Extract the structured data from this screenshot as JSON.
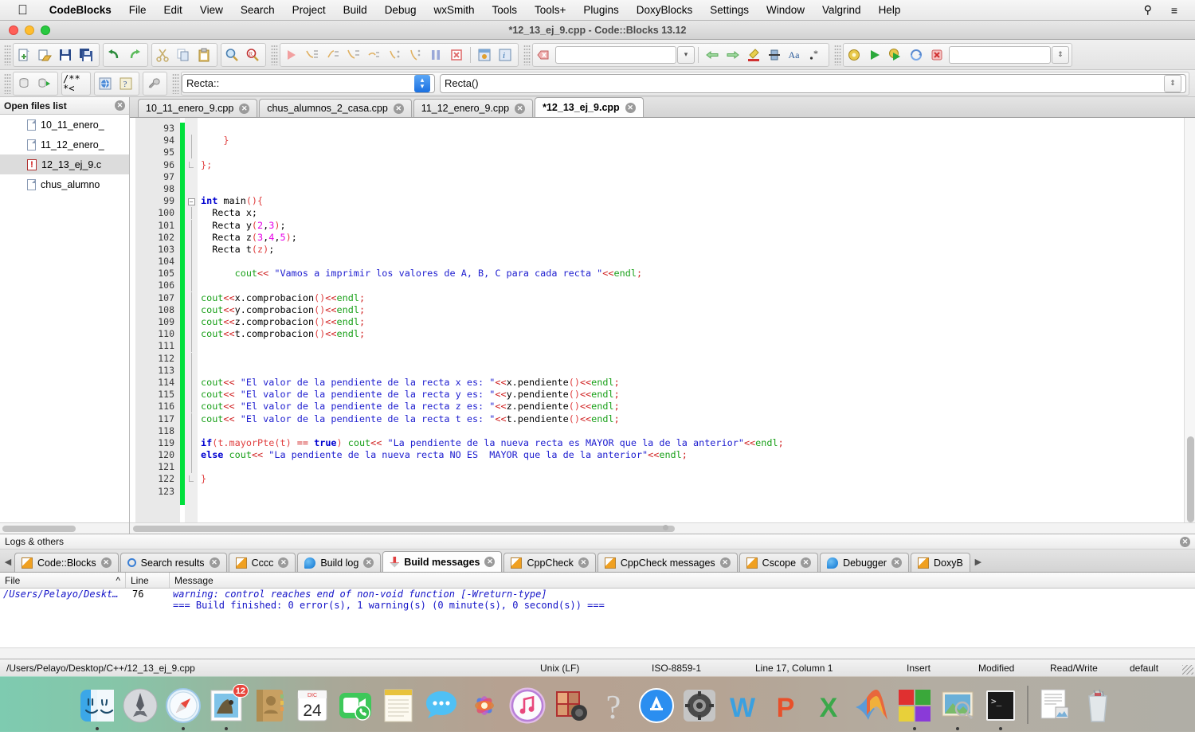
{
  "menubar": {
    "apple_icon": "apple-logo-icon",
    "app_name": "CodeBlocks",
    "items": [
      "File",
      "Edit",
      "View",
      "Search",
      "Project",
      "Build",
      "Debug",
      "wxSmith",
      "Tools",
      "Tools+",
      "Plugins",
      "DoxyBlocks",
      "Settings",
      "Window",
      "Valgrind",
      "Help"
    ],
    "right_icons": [
      "search-icon",
      "control-center-icon"
    ]
  },
  "window": {
    "title": "*12_13_ej_9.cpp - Code::Blocks 13.12"
  },
  "toolbar1": {
    "file_group": [
      "new-file-icon",
      "open-file-icon",
      "save-icon",
      "save-all-icon"
    ],
    "undo_group": [
      "undo-icon",
      "redo-icon"
    ],
    "clipboard_group": [
      "cut-icon",
      "copy-icon",
      "paste-icon"
    ],
    "find_group": [
      "find-icon",
      "replace-icon"
    ],
    "debug_group": [
      "debug-run-icon",
      "debug-next-line-icon",
      "debug-step-into-icon",
      "debug-step-out-icon",
      "debug-next-instruction-icon",
      "debug-step-into-instruction-icon",
      "debug-step-out-function-icon",
      "debug-break-icon",
      "debug-stop-icon",
      "debugging-windows-icon",
      "debug-info-icon"
    ],
    "search_value": "",
    "search_placeholder": "",
    "goto_icons": [
      "prev-icon",
      "next-icon",
      "highlight-icon",
      "bookmark-icon",
      "match-case-icon",
      "regex-icon"
    ],
    "build_group": [
      "build-icon",
      "run-icon",
      "build-and-run-icon",
      "rebuild-icon",
      "abort-icon"
    ],
    "target_value": "",
    "target_placeholder": ""
  },
  "toolbar2": {
    "doxy_group": [
      "doxyblocks-run-icon",
      "doxyblocks-extract-icon"
    ],
    "comment_group": [
      "block-comment-icon",
      "line-comment-icon"
    ],
    "help_group": [
      "doxyblocks-html-icon",
      "doxyblocks-help-icon"
    ],
    "config_group": [
      "doxyblocks-config-icon"
    ],
    "scope_value": "Recta::",
    "function_value": "Recta()"
  },
  "sidebar": {
    "title": "Open files list",
    "close_icon": "close-icon",
    "files": [
      {
        "name": "10_11_enero_",
        "icon": "document-icon",
        "selected": false
      },
      {
        "name": "11_12_enero_",
        "icon": "document-icon",
        "selected": false
      },
      {
        "name": "12_13_ej_9.c",
        "icon": "warning-document-icon",
        "selected": true
      },
      {
        "name": "chus_alumno",
        "icon": "document-icon",
        "selected": false
      }
    ]
  },
  "editor_tabs": [
    {
      "label": "10_11_enero_9.cpp",
      "active": false
    },
    {
      "label": "chus_alumnos_2_casa.cpp",
      "active": false
    },
    {
      "label": "11_12_enero_9.cpp",
      "active": false
    },
    {
      "label": "*12_13_ej_9.cpp",
      "active": true
    }
  ],
  "editor": {
    "first_line": 93,
    "lines": [
      {
        "n": 93,
        "fold": "",
        "tokens": []
      },
      {
        "n": 94,
        "fold": "|",
        "tokens": [
          {
            "t": "    ",
            "c": "k-id"
          },
          {
            "t": "}",
            "c": "k-brace"
          }
        ]
      },
      {
        "n": 95,
        "fold": "|",
        "tokens": []
      },
      {
        "n": 96,
        "fold": "L",
        "tokens": [
          {
            "t": "};",
            "c": "k-brace"
          }
        ]
      },
      {
        "n": 97,
        "fold": "",
        "tokens": []
      },
      {
        "n": 98,
        "fold": "",
        "tokens": []
      },
      {
        "n": 99,
        "fold": "-",
        "tokens": [
          {
            "t": "int",
            "c": "k-type"
          },
          {
            "t": " main",
            "c": "k-id"
          },
          {
            "t": "()",
            "c": "k-paren"
          },
          {
            "t": "{",
            "c": "k-brace"
          }
        ]
      },
      {
        "n": 100,
        "fold": "|",
        "tokens": [
          {
            "t": "  Recta x;",
            "c": "k-id"
          }
        ]
      },
      {
        "n": 101,
        "fold": "|",
        "tokens": [
          {
            "t": "  Recta y",
            "c": "k-id"
          },
          {
            "t": "(",
            "c": "k-paren"
          },
          {
            "t": "2",
            "c": "k-num"
          },
          {
            "t": ",",
            "c": "k-id"
          },
          {
            "t": "3",
            "c": "k-num"
          },
          {
            "t": ")",
            "c": "k-paren"
          },
          {
            "t": ";",
            "c": "k-id"
          }
        ]
      },
      {
        "n": 102,
        "fold": "|",
        "tokens": [
          {
            "t": "  Recta z",
            "c": "k-id"
          },
          {
            "t": "(",
            "c": "k-paren"
          },
          {
            "t": "3",
            "c": "k-num"
          },
          {
            "t": ",",
            "c": "k-id"
          },
          {
            "t": "4",
            "c": "k-num"
          },
          {
            "t": ",",
            "c": "k-id"
          },
          {
            "t": "5",
            "c": "k-num"
          },
          {
            "t": ")",
            "c": "k-paren"
          },
          {
            "t": ";",
            "c": "k-id"
          }
        ]
      },
      {
        "n": 103,
        "fold": "|",
        "tokens": [
          {
            "t": "  Recta t",
            "c": "k-id"
          },
          {
            "t": "(z)",
            "c": "k-paren"
          },
          {
            "t": ";",
            "c": "k-id"
          }
        ]
      },
      {
        "n": 104,
        "fold": "|",
        "tokens": []
      },
      {
        "n": 105,
        "fold": "|",
        "tokens": [
          {
            "t": "      cout",
            "c": "k-std"
          },
          {
            "t": "<<",
            "c": "k-op"
          },
          {
            "t": " \"Vamos a imprimir los valores de A, B, C para cada recta \"",
            "c": "k-str"
          },
          {
            "t": "<<",
            "c": "k-op"
          },
          {
            "t": "endl",
            "c": "k-std"
          },
          {
            "t": ";",
            "c": "k-op"
          }
        ]
      },
      {
        "n": 106,
        "fold": "|",
        "tokens": []
      },
      {
        "n": 107,
        "fold": "|",
        "tokens": [
          {
            "t": "cout",
            "c": "k-std"
          },
          {
            "t": "<<",
            "c": "k-op"
          },
          {
            "t": "x.comprobacion",
            "c": "k-id"
          },
          {
            "t": "()",
            "c": "k-paren"
          },
          {
            "t": "<<",
            "c": "k-op"
          },
          {
            "t": "endl",
            "c": "k-std"
          },
          {
            "t": ";",
            "c": "k-op"
          }
        ]
      },
      {
        "n": 108,
        "fold": "|",
        "tokens": [
          {
            "t": "cout",
            "c": "k-std"
          },
          {
            "t": "<<",
            "c": "k-op"
          },
          {
            "t": "y.comprobacion",
            "c": "k-id"
          },
          {
            "t": "()",
            "c": "k-paren"
          },
          {
            "t": "<<",
            "c": "k-op"
          },
          {
            "t": "endl",
            "c": "k-std"
          },
          {
            "t": ";",
            "c": "k-op"
          }
        ]
      },
      {
        "n": 109,
        "fold": "|",
        "tokens": [
          {
            "t": "cout",
            "c": "k-std"
          },
          {
            "t": "<<",
            "c": "k-op"
          },
          {
            "t": "z.comprobacion",
            "c": "k-id"
          },
          {
            "t": "()",
            "c": "k-paren"
          },
          {
            "t": "<<",
            "c": "k-op"
          },
          {
            "t": "endl",
            "c": "k-std"
          },
          {
            "t": ";",
            "c": "k-op"
          }
        ]
      },
      {
        "n": 110,
        "fold": "|",
        "tokens": [
          {
            "t": "cout",
            "c": "k-std"
          },
          {
            "t": "<<",
            "c": "k-op"
          },
          {
            "t": "t.comprobacion",
            "c": "k-id"
          },
          {
            "t": "()",
            "c": "k-paren"
          },
          {
            "t": "<<",
            "c": "k-op"
          },
          {
            "t": "endl",
            "c": "k-std"
          },
          {
            "t": ";",
            "c": "k-op"
          }
        ]
      },
      {
        "n": 111,
        "fold": "|",
        "tokens": []
      },
      {
        "n": 112,
        "fold": "|",
        "tokens": []
      },
      {
        "n": 113,
        "fold": "|",
        "tokens": []
      },
      {
        "n": 114,
        "fold": "|",
        "tokens": [
          {
            "t": "cout",
            "c": "k-std"
          },
          {
            "t": "<<",
            "c": "k-op"
          },
          {
            "t": " \"El valor de la pendiente de la recta x es: \"",
            "c": "k-str"
          },
          {
            "t": "<<",
            "c": "k-op"
          },
          {
            "t": "x.pendiente",
            "c": "k-id"
          },
          {
            "t": "()",
            "c": "k-paren"
          },
          {
            "t": "<<",
            "c": "k-op"
          },
          {
            "t": "endl",
            "c": "k-std"
          },
          {
            "t": ";",
            "c": "k-op"
          }
        ]
      },
      {
        "n": 115,
        "fold": "|",
        "tokens": [
          {
            "t": "cout",
            "c": "k-std"
          },
          {
            "t": "<<",
            "c": "k-op"
          },
          {
            "t": " \"El valor de la pendiente de la recta y es: \"",
            "c": "k-str"
          },
          {
            "t": "<<",
            "c": "k-op"
          },
          {
            "t": "y.pendiente",
            "c": "k-id"
          },
          {
            "t": "()",
            "c": "k-paren"
          },
          {
            "t": "<<",
            "c": "k-op"
          },
          {
            "t": "endl",
            "c": "k-std"
          },
          {
            "t": ";",
            "c": "k-op"
          }
        ]
      },
      {
        "n": 116,
        "fold": "|",
        "tokens": [
          {
            "t": "cout",
            "c": "k-std"
          },
          {
            "t": "<<",
            "c": "k-op"
          },
          {
            "t": " \"El valor de la pendiente de la recta z es: \"",
            "c": "k-str"
          },
          {
            "t": "<<",
            "c": "k-op"
          },
          {
            "t": "z.pendiente",
            "c": "k-id"
          },
          {
            "t": "()",
            "c": "k-paren"
          },
          {
            "t": "<<",
            "c": "k-op"
          },
          {
            "t": "endl",
            "c": "k-std"
          },
          {
            "t": ";",
            "c": "k-op"
          }
        ]
      },
      {
        "n": 117,
        "fold": "|",
        "tokens": [
          {
            "t": "cout",
            "c": "k-std"
          },
          {
            "t": "<<",
            "c": "k-op"
          },
          {
            "t": " \"El valor de la pendiente de la recta t es: \"",
            "c": "k-str"
          },
          {
            "t": "<<",
            "c": "k-op"
          },
          {
            "t": "t.pendiente",
            "c": "k-id"
          },
          {
            "t": "()",
            "c": "k-paren"
          },
          {
            "t": "<<",
            "c": "k-op"
          },
          {
            "t": "endl",
            "c": "k-std"
          },
          {
            "t": ";",
            "c": "k-op"
          }
        ]
      },
      {
        "n": 118,
        "fold": "|",
        "tokens": []
      },
      {
        "n": 119,
        "fold": "|",
        "tokens": [
          {
            "t": "if",
            "c": "k-kw"
          },
          {
            "t": "(t.mayorPte",
            "c": "k-paren"
          },
          {
            "t": "(t)",
            "c": "k-paren"
          },
          {
            "t": " ",
            "c": "k-id"
          },
          {
            "t": "==",
            "c": "k-op"
          },
          {
            "t": " ",
            "c": "k-id"
          },
          {
            "t": "true",
            "c": "k-kw"
          },
          {
            "t": ")",
            "c": "k-paren"
          },
          {
            "t": " cout",
            "c": "k-std"
          },
          {
            "t": "<<",
            "c": "k-op"
          },
          {
            "t": " \"La pendiente de la nueva recta es MAYOR que la de la anterior\"",
            "c": "k-str"
          },
          {
            "t": "<<",
            "c": "k-op"
          },
          {
            "t": "endl",
            "c": "k-std"
          },
          {
            "t": ";",
            "c": "k-op"
          }
        ]
      },
      {
        "n": 120,
        "fold": "|",
        "tokens": [
          {
            "t": "else",
            "c": "k-kw"
          },
          {
            "t": " cout",
            "c": "k-std"
          },
          {
            "t": "<<",
            "c": "k-op"
          },
          {
            "t": " \"La pendiente de la nueva recta NO ES  MAYOR que la de la anterior\"",
            "c": "k-str"
          },
          {
            "t": "<<",
            "c": "k-op"
          },
          {
            "t": "endl",
            "c": "k-std"
          },
          {
            "t": ";",
            "c": "k-op"
          }
        ]
      },
      {
        "n": 121,
        "fold": "|",
        "tokens": []
      },
      {
        "n": 122,
        "fold": "L",
        "tokens": [
          {
            "t": "}",
            "c": "k-brace"
          }
        ]
      },
      {
        "n": 123,
        "fold": "",
        "tokens": []
      }
    ]
  },
  "logs": {
    "panel_title": "Logs & others",
    "close_icon": "close-icon",
    "scroll_left_icon": "chevron-left-icon",
    "scroll_right_icon": "chevron-right-icon",
    "tabs": [
      {
        "label": "Code::Blocks",
        "icon": "pencil-icon",
        "active": false
      },
      {
        "label": "Search results",
        "icon": "magnifier-icon",
        "active": false
      },
      {
        "label": "Cccc",
        "icon": "pencil-icon",
        "active": false
      },
      {
        "label": "Build log",
        "icon": "gear-blue-icon",
        "active": false
      },
      {
        "label": "Build messages",
        "icon": "pin-icon",
        "active": true
      },
      {
        "label": "CppCheck",
        "icon": "pencil-icon",
        "active": false
      },
      {
        "label": "CppCheck messages",
        "icon": "pencil-icon",
        "active": false
      },
      {
        "label": "Cscope",
        "icon": "pencil-icon",
        "active": false
      },
      {
        "label": "Debugger",
        "icon": "gear-blue-icon",
        "active": false
      },
      {
        "label": "DoxyB",
        "icon": "pencil-icon",
        "active": false
      }
    ],
    "columns": [
      "File",
      "Line",
      "Message"
    ],
    "sort_indicator": "^",
    "rows": [
      {
        "file": "/Users/Pelayo/Deskt…",
        "line": "76",
        "message": "warning: control reaches end of non-void function [-Wreturn-type]",
        "style": "italic"
      },
      {
        "file": "",
        "line": "",
        "message": "=== Build finished: 0 error(s), 1 warning(s) (0 minute(s), 0 second(s)) ===",
        "style": "plain"
      }
    ]
  },
  "statusbar": {
    "path": "/Users/Pelayo/Desktop/C++/12_13_ej_9.cpp",
    "eol": "Unix (LF)",
    "encoding": "ISO-8859-1",
    "position": "Line 17, Column 1",
    "insert_mode": "Insert",
    "modified": "Modified",
    "permissions": "Read/Write",
    "personality": "default"
  },
  "dock": {
    "items": [
      {
        "name": "finder",
        "running": true
      },
      {
        "name": "launchpad",
        "running": false
      },
      {
        "name": "safari",
        "running": true
      },
      {
        "name": "mail",
        "running": true,
        "badge": "12"
      },
      {
        "name": "contacts",
        "running": false
      },
      {
        "name": "calendar",
        "running": false,
        "month": "DIC",
        "day": "24"
      },
      {
        "name": "facetime",
        "running": false
      },
      {
        "name": "notes",
        "running": false
      },
      {
        "name": "messages",
        "running": false
      },
      {
        "name": "photos",
        "running": false
      },
      {
        "name": "itunes",
        "running": false
      },
      {
        "name": "photo-booth",
        "running": false
      },
      {
        "name": "help-viewer",
        "running": false
      },
      {
        "name": "app-store",
        "running": false
      },
      {
        "name": "system-preferences",
        "running": false
      },
      {
        "name": "microsoft-word",
        "running": false
      },
      {
        "name": "microsoft-powerpoint",
        "running": false
      },
      {
        "name": "microsoft-excel",
        "running": false
      },
      {
        "name": "matlab",
        "running": false
      },
      {
        "name": "codeblocks",
        "running": true
      },
      {
        "name": "preview",
        "running": true
      },
      {
        "name": "terminal",
        "running": true
      }
    ],
    "right_items": [
      {
        "name": "documents-stack"
      },
      {
        "name": "trash"
      }
    ]
  },
  "colors": {
    "accent_green": "#00e03c",
    "string_blue": "#2020d0",
    "keyword_blue": "#0000d0",
    "number_magenta": "#e800e8",
    "operator_red": "#d02020",
    "std_green": "#19a019",
    "badge_red": "#e8453c"
  }
}
